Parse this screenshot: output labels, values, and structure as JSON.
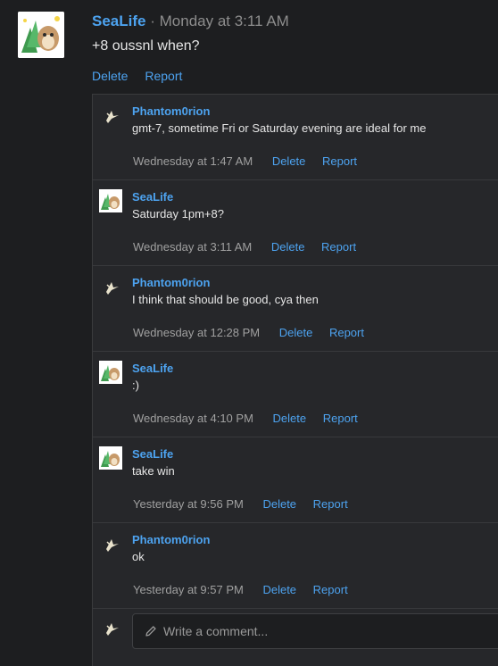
{
  "post": {
    "author": "SeaLife",
    "separator": "·",
    "timestamp": "Monday at 3:11 AM",
    "body": "+8 oussnl when?",
    "actions": {
      "delete": "Delete",
      "report": "Report"
    }
  },
  "comments": [
    {
      "author": "Phantom0rion",
      "avatar": "glider-icon",
      "text": "gmt-7, sometime Fri or Saturday evening are ideal for me",
      "time": "Wednesday at 1:47 AM",
      "delete": "Delete",
      "report": "Report"
    },
    {
      "author": "SeaLife",
      "avatar": "sealife-avatar",
      "text": "Saturday 1pm+8?",
      "time": "Wednesday at 3:11 AM",
      "delete": "Delete",
      "report": "Report"
    },
    {
      "author": "Phantom0rion",
      "avatar": "glider-icon",
      "text": "I think that should be good, cya then",
      "time": "Wednesday at 12:28 PM",
      "delete": "Delete",
      "report": "Report"
    },
    {
      "author": "SeaLife",
      "avatar": "sealife-avatar",
      "text": ":)",
      "time": "Wednesday at 4:10 PM",
      "delete": "Delete",
      "report": "Report"
    },
    {
      "author": "SeaLife",
      "avatar": "sealife-avatar",
      "text": "take win",
      "time": "Yesterday at 9:56 PM",
      "delete": "Delete",
      "report": "Report"
    },
    {
      "author": "Phantom0rion",
      "avatar": "glider-icon",
      "text": "ok",
      "time": "Yesterday at 9:57 PM",
      "delete": "Delete",
      "report": "Report"
    }
  ],
  "write_comment": {
    "placeholder": "Write a comment...",
    "icon": "pencil-icon"
  },
  "colors": {
    "background": "#1d1e20",
    "comments_bg": "#26272a",
    "link": "#4da3f0",
    "muted": "#a0a0a0"
  }
}
